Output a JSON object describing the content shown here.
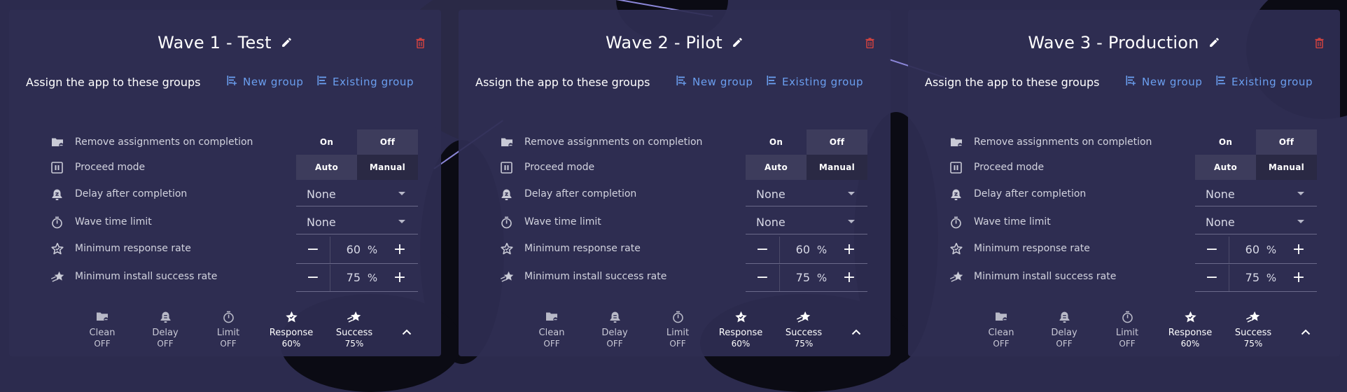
{
  "assign_text": "Assign the app to these groups",
  "new_group_label": "New group",
  "existing_group_label": "Existing group",
  "settings_labels": {
    "remove": "Remove assignments on completion",
    "proceed": "Proceed mode",
    "delay": "Delay after completion",
    "limit": "Wave time limit",
    "response": "Minimum response rate",
    "success": "Minimum install success rate"
  },
  "toggle_options": {
    "on": "On",
    "off": "Off",
    "auto": "Auto",
    "manual": "Manual"
  },
  "percent_sign": "%",
  "summary_labels": {
    "clean": "Clean",
    "delay": "Delay",
    "limit": "Limit",
    "response": "Response",
    "success": "Success"
  },
  "colors": {
    "accent_link": "#6b9ff0",
    "delete": "#d9443f",
    "card_bg": "#2e2d52"
  },
  "waves": [
    {
      "title": "Wave 1 - Test",
      "remove_on_completion": "Off",
      "proceed_mode": "Auto",
      "delay_after_completion": "None",
      "wave_time_limit": "None",
      "min_response_rate": "60",
      "min_install_success_rate": "75",
      "summary": {
        "clean": "OFF",
        "delay": "OFF",
        "limit": "OFF",
        "response": "60%",
        "success": "75%"
      }
    },
    {
      "title": "Wave 2 - Pilot",
      "remove_on_completion": "Off",
      "proceed_mode": "Auto",
      "delay_after_completion": "None",
      "wave_time_limit": "None",
      "min_response_rate": "60",
      "min_install_success_rate": "75",
      "summary": {
        "clean": "OFF",
        "delay": "OFF",
        "limit": "OFF",
        "response": "60%",
        "success": "75%"
      }
    },
    {
      "title": "Wave 3 - Production",
      "remove_on_completion": "Off",
      "proceed_mode": "Auto",
      "delay_after_completion": "None",
      "wave_time_limit": "None",
      "min_response_rate": "60",
      "min_install_success_rate": "75",
      "summary": {
        "clean": "OFF",
        "delay": "OFF",
        "limit": "OFF",
        "response": "60%",
        "success": "75%"
      }
    }
  ]
}
